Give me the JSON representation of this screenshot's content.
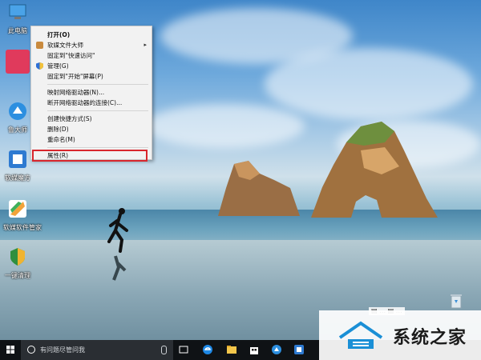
{
  "desktop": {
    "icons": [
      {
        "label": "此电脑",
        "icon": "this-pc-icon"
      },
      {
        "label": "",
        "icon": "user-folder-icon"
      },
      {
        "label": "鲁大师",
        "icon": "ludashi-icon"
      },
      {
        "label": "软媒魔方",
        "icon": "ruanmei-icon"
      },
      {
        "label": "软媒软件管家",
        "icon": "software-manager-icon"
      },
      {
        "label": "一键清理",
        "icon": "cleanup-icon"
      }
    ]
  },
  "context_menu": {
    "items": [
      {
        "label": "打开(O)",
        "bold": true
      },
      {
        "label": "软媒文件大师",
        "icon": "file-master-icon",
        "submenu": true
      },
      {
        "label": "固定到\"快速访问\""
      },
      {
        "label": "管理(G)",
        "icon": "shield-icon"
      },
      {
        "label": "固定到\"开始\"屏幕(P)"
      },
      {
        "label": "映射网络驱动器(N)..."
      },
      {
        "label": "断开网络驱动器的连接(C)..."
      },
      {
        "label": "创建快捷方式(S)"
      },
      {
        "label": "删除(D)"
      },
      {
        "label": "重命名(M)"
      },
      {
        "label": "属性(R)",
        "highlighted": true
      }
    ]
  },
  "taskbar": {
    "search_placeholder": "有问题尽管问我",
    "pinned": [
      "task-view-icon",
      "edge-icon",
      "file-explorer-icon",
      "store-icon",
      "ludashi-icon",
      "ruanmei-icon"
    ]
  },
  "watermark": {
    "text": "系统之家"
  },
  "colors": {
    "highlight_border": "#d8262d",
    "taskbar": "#0f1215",
    "menu_bg": "#f2f2f2"
  }
}
